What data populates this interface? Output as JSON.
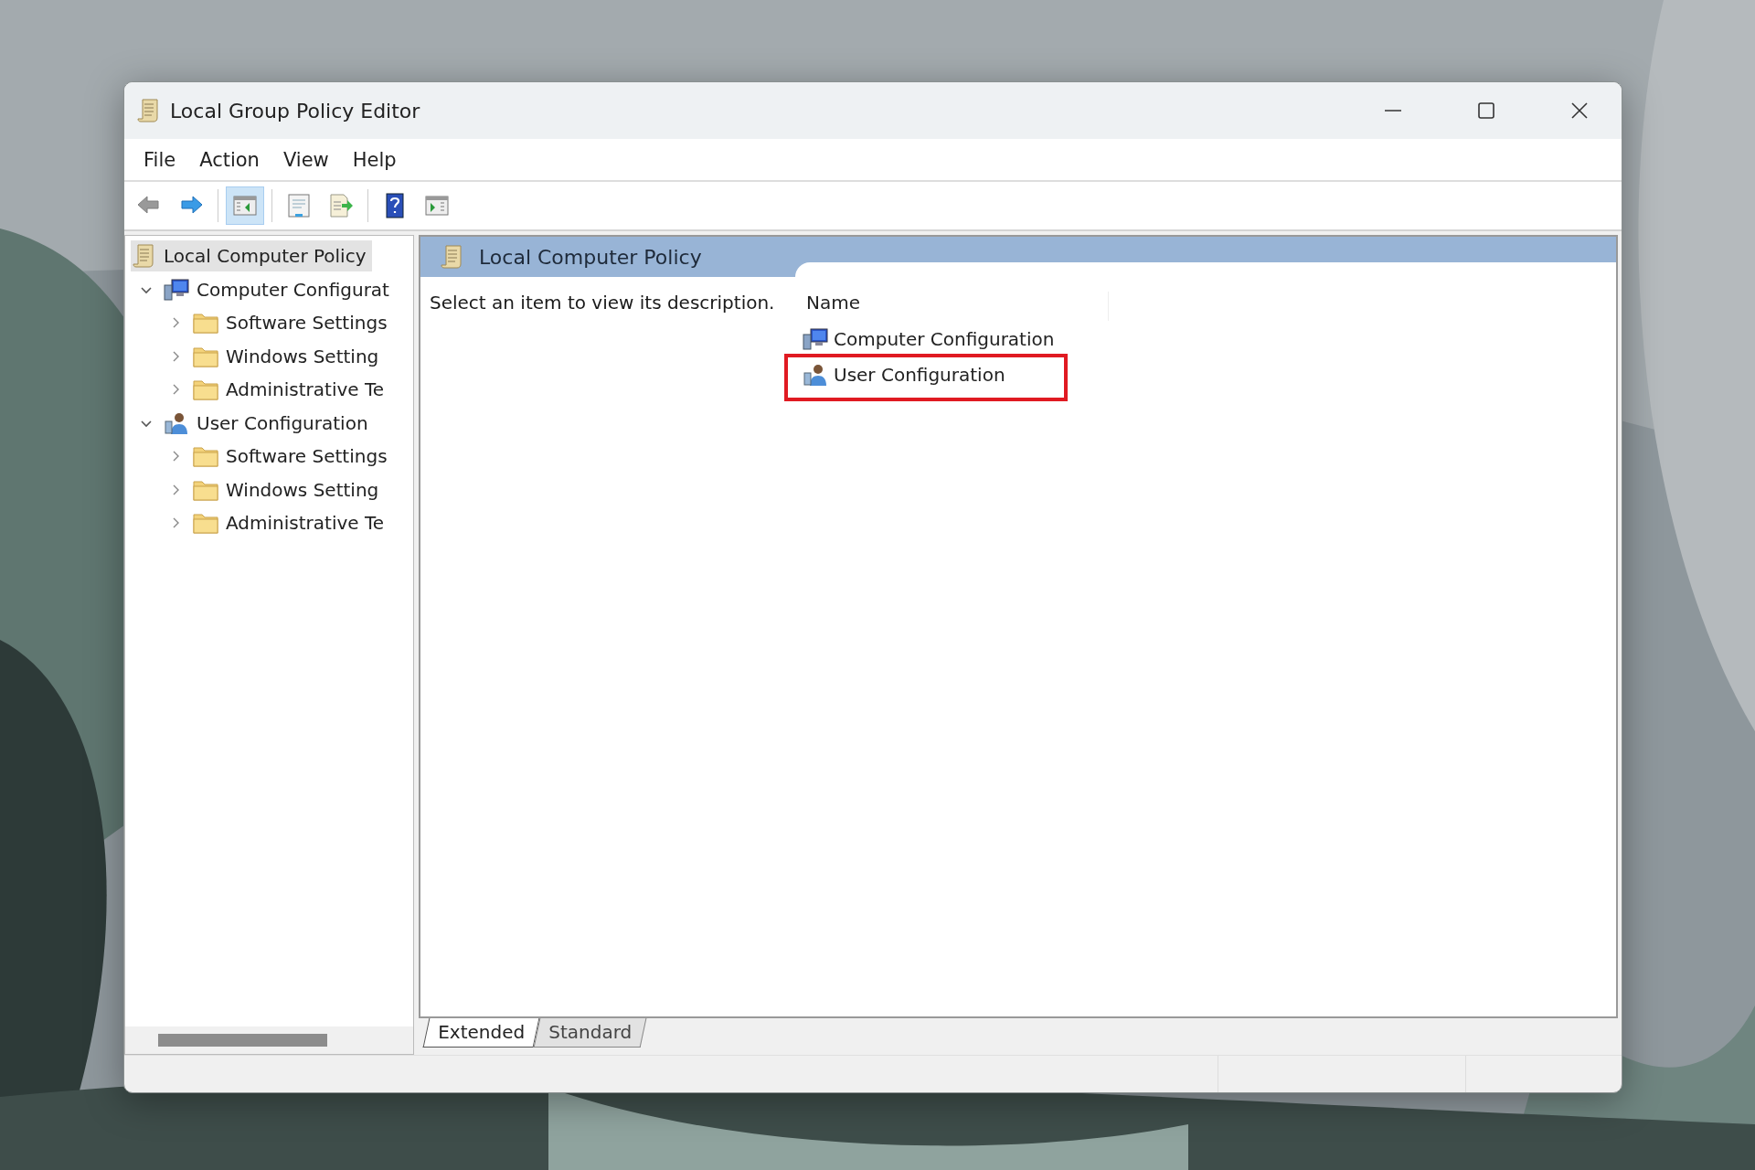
{
  "window": {
    "title": "Local Group Policy Editor"
  },
  "menu": [
    "File",
    "Action",
    "View",
    "Help"
  ],
  "toolbar": [
    {
      "kind": "back",
      "disabled": true,
      "selected": false
    },
    {
      "kind": "forward",
      "disabled": false,
      "selected": false
    },
    {
      "kind": "separator"
    },
    {
      "kind": "tree-toggle",
      "disabled": false,
      "selected": true
    },
    {
      "kind": "separator"
    },
    {
      "kind": "properties",
      "disabled": false,
      "selected": false
    },
    {
      "kind": "export",
      "disabled": false,
      "selected": false
    },
    {
      "kind": "separator"
    },
    {
      "kind": "help",
      "disabled": false,
      "selected": false
    },
    {
      "kind": "action-pane",
      "disabled": false,
      "selected": false
    }
  ],
  "tree": [
    {
      "label": "Local Computer Policy",
      "kind": "policy",
      "selected": true,
      "children": [
        {
          "label": "Computer Configurat",
          "kind": "computer",
          "selected": false,
          "expanded": true,
          "children": [
            {
              "label": "Software Settings",
              "kind": "folder",
              "selected": false,
              "expanded": false
            },
            {
              "label": "Windows Setting",
              "kind": "folder",
              "selected": false,
              "expanded": false
            },
            {
              "label": "Administrative Te",
              "kind": "folder",
              "selected": false,
              "expanded": false
            }
          ]
        },
        {
          "label": "User Configuration",
          "kind": "user",
          "selected": false,
          "expanded": true,
          "children": [
            {
              "label": "Software Settings",
              "kind": "folder",
              "selected": false,
              "expanded": false
            },
            {
              "label": "Windows Setting",
              "kind": "folder",
              "selected": false,
              "expanded": false
            },
            {
              "label": "Administrative Te",
              "kind": "folder",
              "selected": false,
              "expanded": false
            }
          ]
        }
      ]
    }
  ],
  "details": {
    "title": "Local Computer Policy",
    "description": "Select an item to view its description.",
    "column": "Name",
    "items": [
      {
        "label": "Computer Configuration",
        "kind": "computer",
        "highlighted": false
      },
      {
        "label": "User Configuration",
        "kind": "user",
        "highlighted": true
      }
    ]
  },
  "view_tabs": [
    {
      "label": "Extended",
      "selected": true
    },
    {
      "label": "Standard",
      "selected": false
    }
  ]
}
